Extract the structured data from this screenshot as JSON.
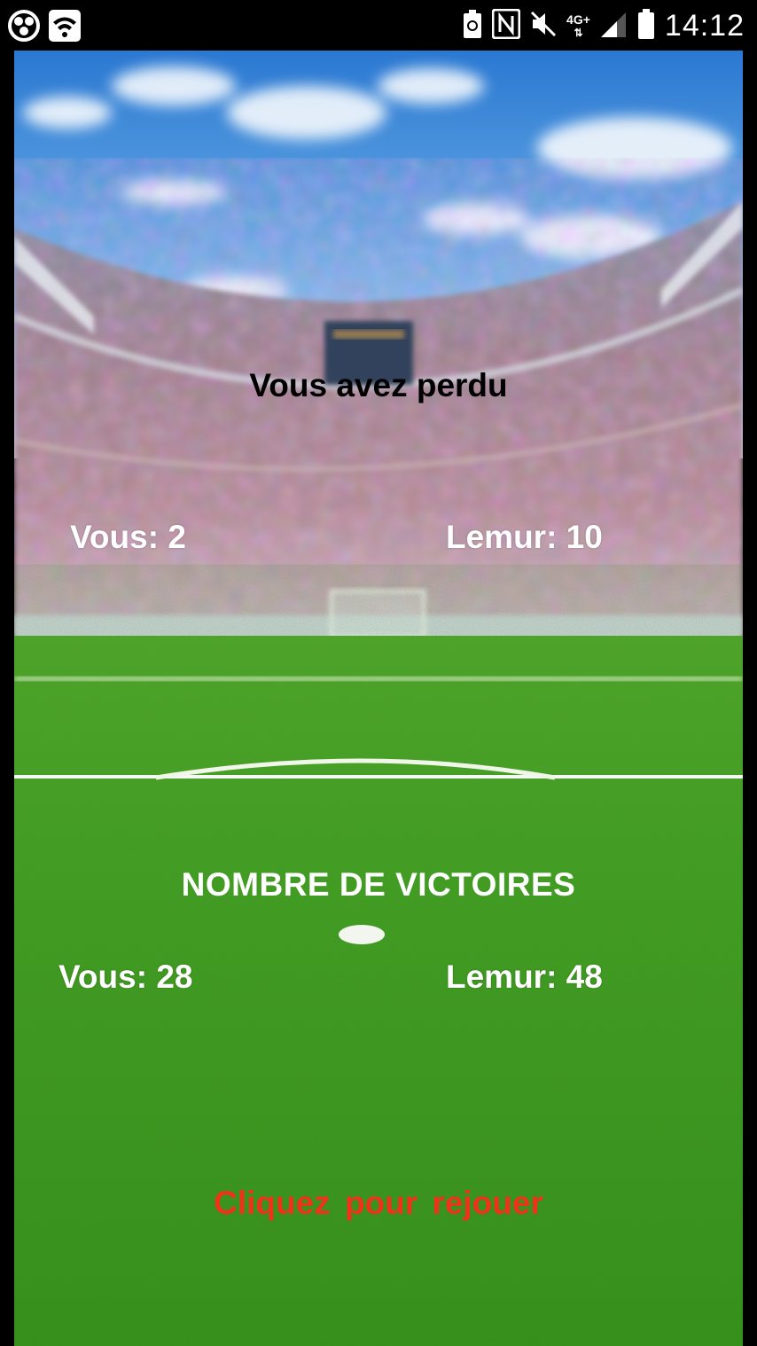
{
  "status_bar": {
    "time": "14:12",
    "network": "4G+",
    "icons": [
      "app-icon",
      "wifi-icon",
      "battery-saver-icon",
      "nfc-icon",
      "mute-icon",
      "signal-icon",
      "battery-icon"
    ]
  },
  "game": {
    "result_title": "Vous avez perdu",
    "score": {
      "you_label": "Vous: 2",
      "lemur_label": "Lemur: 10"
    },
    "wins": {
      "title": "NOMBRE DE VICTOIRES",
      "you_label": "Vous: 28",
      "lemur_label": "Lemur: 48"
    },
    "replay_label": "Cliquez  pour rejouer"
  },
  "colors": {
    "sky_top": "#2f7fd6",
    "sky_bottom": "#bcd8ee",
    "pitch": "#3fa21c",
    "pitch_dark": "#2d8a12",
    "replay": "#ee3319"
  }
}
